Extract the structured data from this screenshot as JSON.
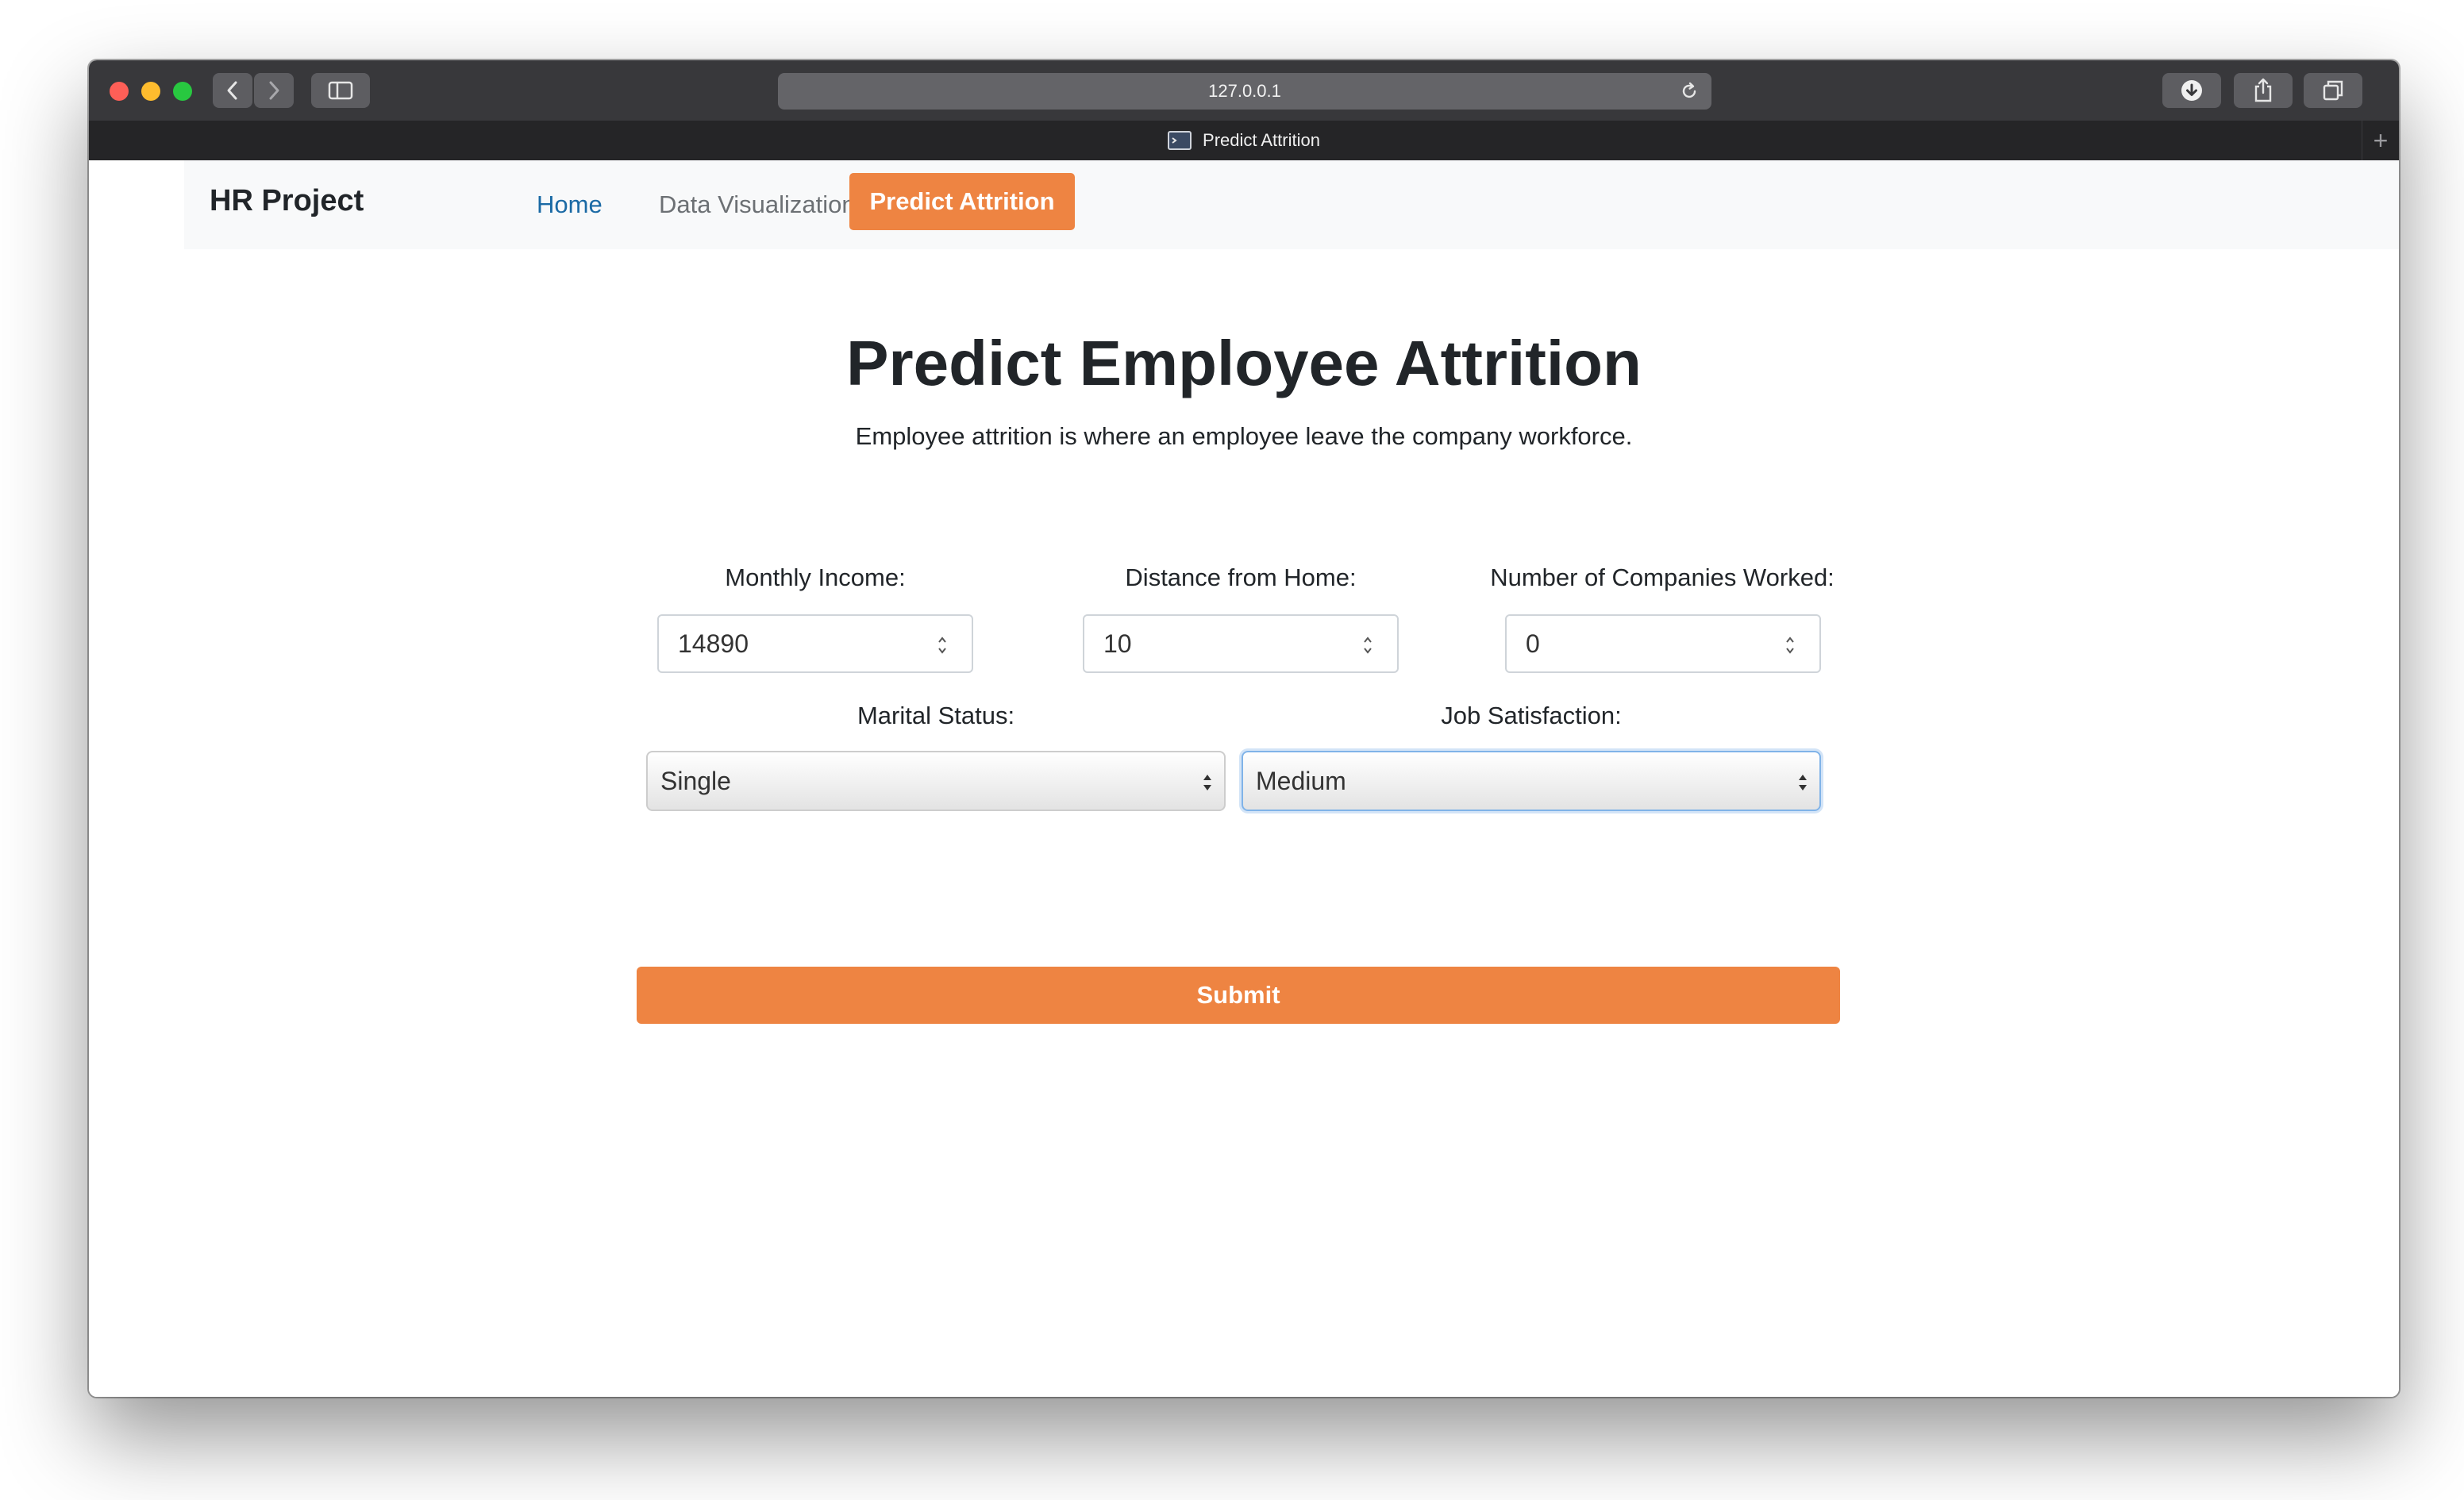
{
  "browser": {
    "url": "127.0.0.1",
    "tab_title": "Predict Attrition"
  },
  "navbar": {
    "brand": "HR Project",
    "items": [
      {
        "label": "Home"
      },
      {
        "label": "Data Visualization"
      },
      {
        "label": "Predict Attrition"
      }
    ]
  },
  "page": {
    "title": "Predict Employee Attrition",
    "subtitle": "Employee attrition is where an employee leave the company workforce."
  },
  "form": {
    "monthly_income": {
      "label": "Monthly Income:",
      "value": "14890"
    },
    "distance_from_home": {
      "label": "Distance from Home:",
      "value": "10"
    },
    "num_companies_worked": {
      "label": "Number of Companies Worked:",
      "value": "0"
    },
    "marital_status": {
      "label": "Marital Status:",
      "value": "Single"
    },
    "job_satisfaction": {
      "label": "Job Satisfaction:",
      "value": "Medium"
    },
    "submit_label": "Submit"
  },
  "colors": {
    "accent": "#ee8442",
    "link": "#1b6aa5",
    "navbar_bg": "#f8f9fa",
    "toolbar_bg": "#38383b"
  }
}
